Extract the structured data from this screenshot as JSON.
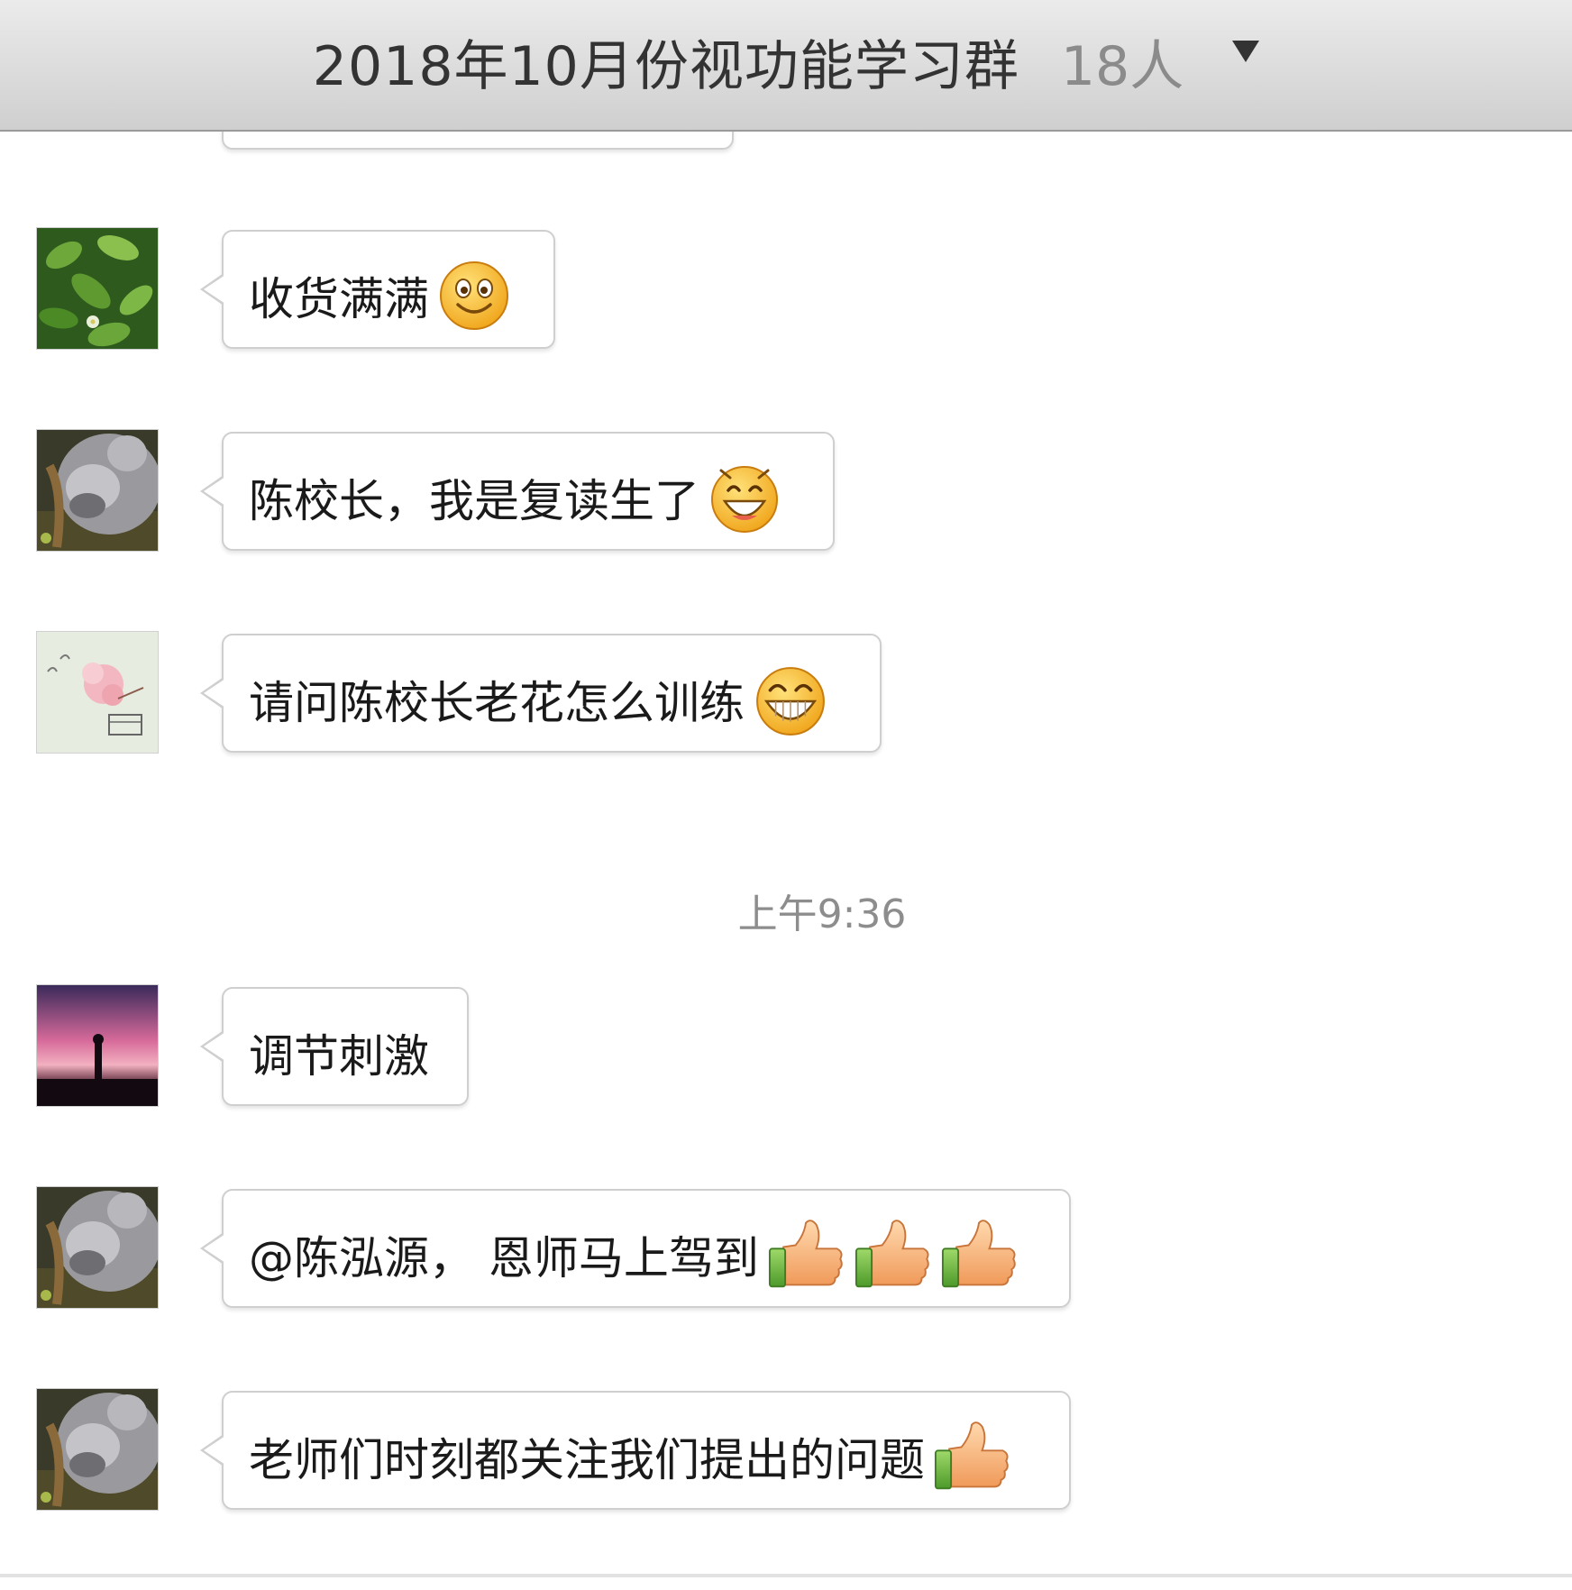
{
  "header": {
    "group_name": "2018年10月份视功能学习群",
    "member_count": "18人",
    "menu_icon": "dropdown-triangle-icon"
  },
  "messages": [
    {
      "avatar": "leaves-avatar",
      "text": "收货满满",
      "emoji": "smile-emoji"
    },
    {
      "avatar": "koala-avatar",
      "text": "陈校长，我是复读生了",
      "emoji": "grin-emoji"
    },
    {
      "avatar": "flower-sketch-avatar",
      "text": "请问陈校长老花怎么训练",
      "emoji": "big-grin-emoji"
    },
    {
      "avatar": "sunset-avatar",
      "text": "调节刺激"
    },
    {
      "avatar": "koala-avatar",
      "text": "@陈泓源， 恩师马上驾到",
      "emoji": "thumbs-up-emoji",
      "emoji_count": 3
    },
    {
      "avatar": "koala-avatar",
      "text": "老师们时刻都关注我们提出的问题",
      "emoji": "thumbs-up-emoji",
      "emoji_count": 1
    }
  ],
  "timestamp": "上午9:36"
}
